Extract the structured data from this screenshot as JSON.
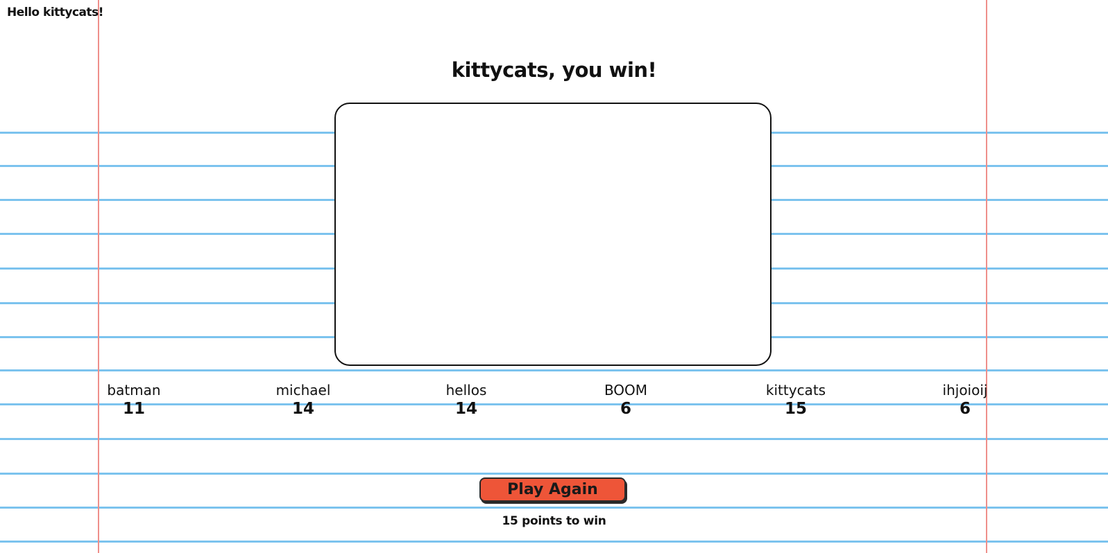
{
  "greeting": "Hello kittycats!",
  "result_title": "kittycats, you win!",
  "players": [
    {
      "name": "batman",
      "score": "11"
    },
    {
      "name": "michael",
      "score": "14"
    },
    {
      "name": "hellos",
      "score": "14"
    },
    {
      "name": "BOOM",
      "score": "6"
    },
    {
      "name": "kittycats",
      "score": "15"
    },
    {
      "name": "ihjoioij",
      "score": "6"
    }
  ],
  "play_again_label": "Play Again",
  "win_condition": "15 points to win",
  "colors": {
    "paper_rule_line": "#7cc3ee",
    "margin_line": "#ef8f8a",
    "play_again_button": "#ee5538"
  }
}
